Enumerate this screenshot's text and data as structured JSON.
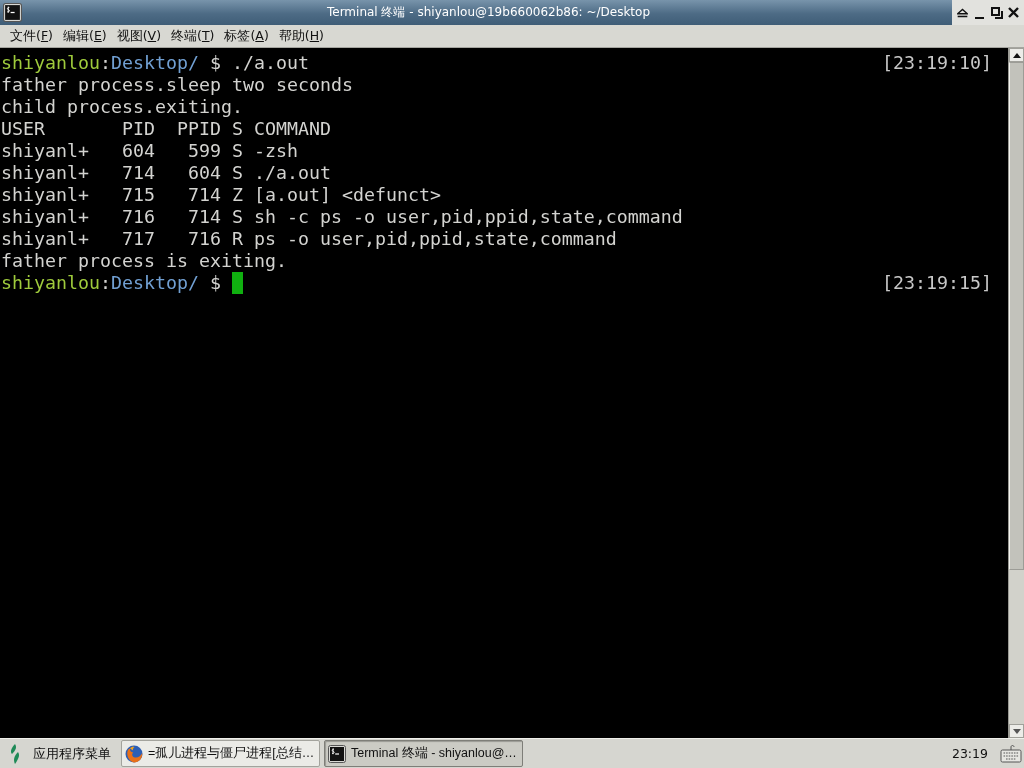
{
  "window": {
    "title": "Terminal 终端 - shiyanlou@19b660062b86: ~/Desktop"
  },
  "menu": [
    "文件(F)",
    "编辑(E)",
    "视图(V)",
    "终端(T)",
    "标签(A)",
    "帮助(H)"
  ],
  "terminal": {
    "lines": [
      {
        "kind": "prompt",
        "user": "shiyanlou",
        "separator": ":",
        "path": "Desktop/",
        "symbol": "$",
        "command": "./a.out",
        "time": "[23:19:10]",
        "cursor": false
      },
      {
        "kind": "output",
        "text": "father process.sleep two seconds"
      },
      {
        "kind": "output",
        "text": "child process.exiting."
      },
      {
        "kind": "output",
        "text": "USER       PID  PPID S COMMAND"
      },
      {
        "kind": "output",
        "text": "shiyanl+   604   599 S -zsh"
      },
      {
        "kind": "output",
        "text": "shiyanl+   714   604 S ./a.out"
      },
      {
        "kind": "output",
        "text": "shiyanl+   715   714 Z [a.out] <defunct>"
      },
      {
        "kind": "output",
        "text": "shiyanl+   716   714 S sh -c ps -o user,pid,ppid,state,command"
      },
      {
        "kind": "output",
        "text": "shiyanl+   717   716 R ps -o user,pid,ppid,state,command"
      },
      {
        "kind": "output",
        "text": "father process is exiting."
      },
      {
        "kind": "prompt",
        "user": "shiyanlou",
        "separator": ":",
        "path": "Desktop/",
        "symbol": "$",
        "time": "[23:19:15]",
        "cursor": true
      }
    ]
  },
  "taskbar": {
    "menu_button": "应用程序菜单",
    "tasks": [
      {
        "kind": "browser",
        "label": "=孤儿进程与僵尸进程[总结…",
        "selected": false
      },
      {
        "kind": "terminal",
        "label": "Terminal 终端 - shiyanlou@…",
        "selected": true
      }
    ],
    "clock": "23:19"
  }
}
